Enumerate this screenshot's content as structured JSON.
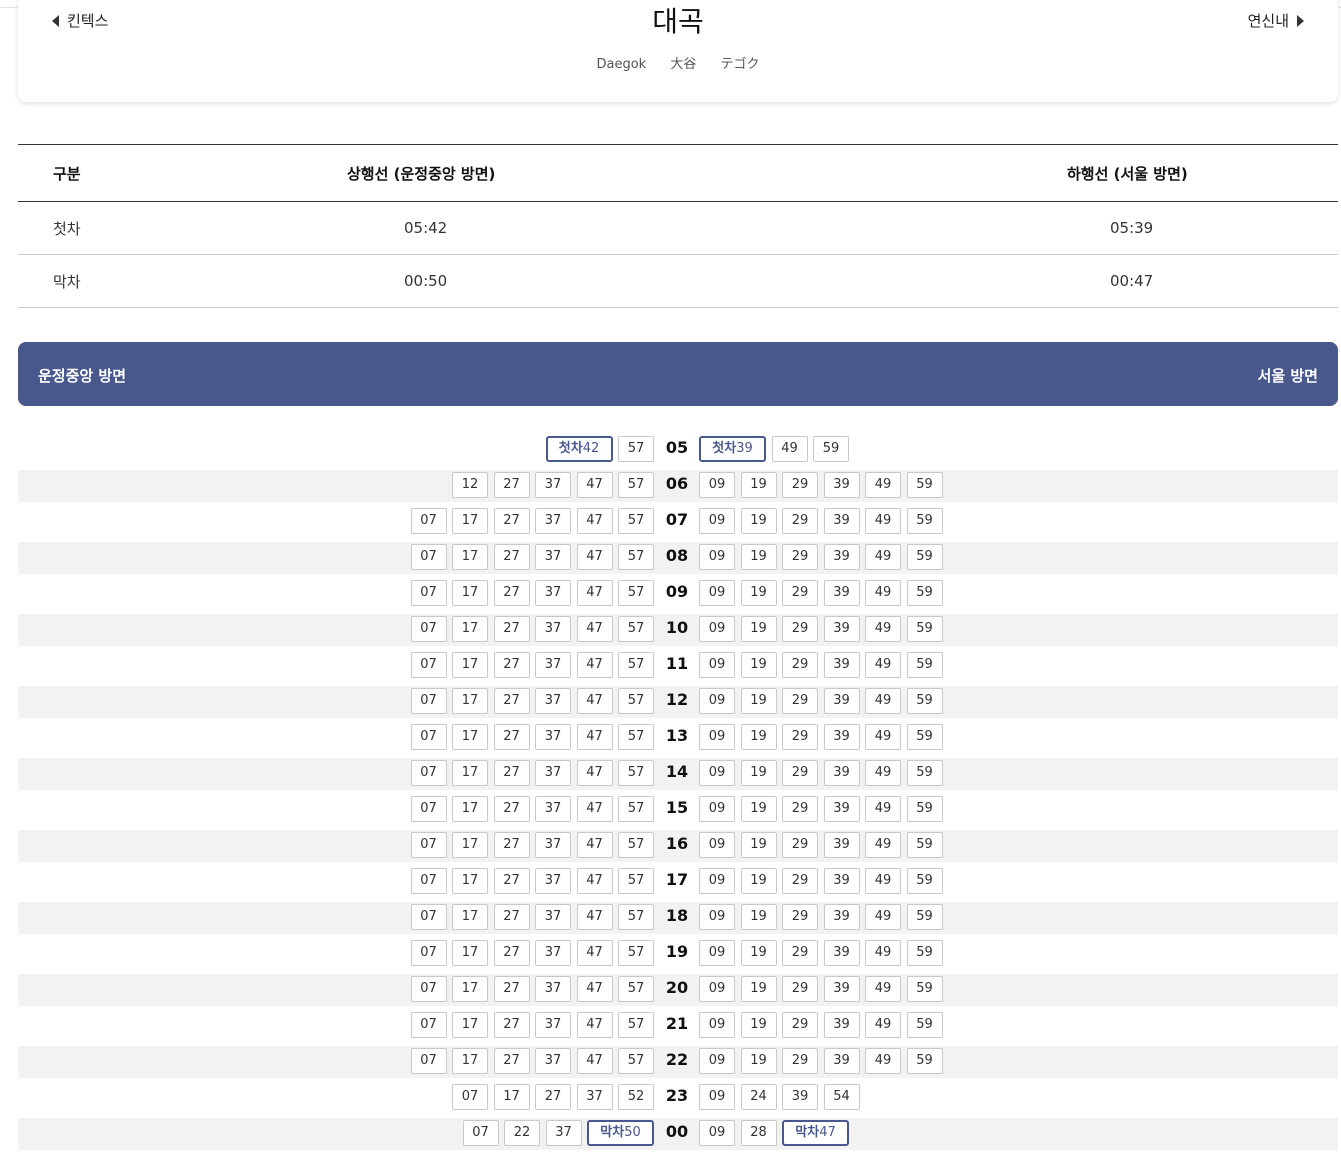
{
  "station": {
    "prev": "킨텍스",
    "next": "연신내",
    "name": "대곡",
    "en": "Daegok",
    "zh": "大谷",
    "ja": "テゴク"
  },
  "summary": {
    "headers": [
      "구분",
      "상행선 (운정중앙 방면)",
      "하행선 (서울 방면)"
    ],
    "rows": [
      [
        "첫차",
        "05:42",
        "05:39"
      ],
      [
        "막차",
        "00:50",
        "00:47"
      ]
    ]
  },
  "directions": {
    "left": "운정중앙 방면",
    "right": "서울 방면"
  },
  "badges": {
    "first": "첫차",
    "last": "막차"
  },
  "timetable": [
    {
      "hour": "05",
      "up": [
        "첫차42",
        "57"
      ],
      "down": [
        "첫차39",
        "49",
        "59"
      ]
    },
    {
      "hour": "06",
      "up": [
        "12",
        "27",
        "37",
        "47",
        "57"
      ],
      "down": [
        "09",
        "19",
        "29",
        "39",
        "49",
        "59"
      ]
    },
    {
      "hour": "07",
      "up": [
        "07",
        "17",
        "27",
        "37",
        "47",
        "57"
      ],
      "down": [
        "09",
        "19",
        "29",
        "39",
        "49",
        "59"
      ]
    },
    {
      "hour": "08",
      "up": [
        "07",
        "17",
        "27",
        "37",
        "47",
        "57"
      ],
      "down": [
        "09",
        "19",
        "29",
        "39",
        "49",
        "59"
      ]
    },
    {
      "hour": "09",
      "up": [
        "07",
        "17",
        "27",
        "37",
        "47",
        "57"
      ],
      "down": [
        "09",
        "19",
        "29",
        "39",
        "49",
        "59"
      ]
    },
    {
      "hour": "10",
      "up": [
        "07",
        "17",
        "27",
        "37",
        "47",
        "57"
      ],
      "down": [
        "09",
        "19",
        "29",
        "39",
        "49",
        "59"
      ]
    },
    {
      "hour": "11",
      "up": [
        "07",
        "17",
        "27",
        "37",
        "47",
        "57"
      ],
      "down": [
        "09",
        "19",
        "29",
        "39",
        "49",
        "59"
      ]
    },
    {
      "hour": "12",
      "up": [
        "07",
        "17",
        "27",
        "37",
        "47",
        "57"
      ],
      "down": [
        "09",
        "19",
        "29",
        "39",
        "49",
        "59"
      ]
    },
    {
      "hour": "13",
      "up": [
        "07",
        "17",
        "27",
        "37",
        "47",
        "57"
      ],
      "down": [
        "09",
        "19",
        "29",
        "39",
        "49",
        "59"
      ]
    },
    {
      "hour": "14",
      "up": [
        "07",
        "17",
        "27",
        "37",
        "47",
        "57"
      ],
      "down": [
        "09",
        "19",
        "29",
        "39",
        "49",
        "59"
      ]
    },
    {
      "hour": "15",
      "up": [
        "07",
        "17",
        "27",
        "37",
        "47",
        "57"
      ],
      "down": [
        "09",
        "19",
        "29",
        "39",
        "49",
        "59"
      ]
    },
    {
      "hour": "16",
      "up": [
        "07",
        "17",
        "27",
        "37",
        "47",
        "57"
      ],
      "down": [
        "09",
        "19",
        "29",
        "39",
        "49",
        "59"
      ]
    },
    {
      "hour": "17",
      "up": [
        "07",
        "17",
        "27",
        "37",
        "47",
        "57"
      ],
      "down": [
        "09",
        "19",
        "29",
        "39",
        "49",
        "59"
      ]
    },
    {
      "hour": "18",
      "up": [
        "07",
        "17",
        "27",
        "37",
        "47",
        "57"
      ],
      "down": [
        "09",
        "19",
        "29",
        "39",
        "49",
        "59"
      ]
    },
    {
      "hour": "19",
      "up": [
        "07",
        "17",
        "27",
        "37",
        "47",
        "57"
      ],
      "down": [
        "09",
        "19",
        "29",
        "39",
        "49",
        "59"
      ]
    },
    {
      "hour": "20",
      "up": [
        "07",
        "17",
        "27",
        "37",
        "47",
        "57"
      ],
      "down": [
        "09",
        "19",
        "29",
        "39",
        "49",
        "59"
      ]
    },
    {
      "hour": "21",
      "up": [
        "07",
        "17",
        "27",
        "37",
        "47",
        "57"
      ],
      "down": [
        "09",
        "19",
        "29",
        "39",
        "49",
        "59"
      ]
    },
    {
      "hour": "22",
      "up": [
        "07",
        "17",
        "27",
        "37",
        "47",
        "57"
      ],
      "down": [
        "09",
        "19",
        "29",
        "39",
        "49",
        "59"
      ]
    },
    {
      "hour": "23",
      "up": [
        "07",
        "17",
        "27",
        "37",
        "52"
      ],
      "down": [
        "09",
        "24",
        "39",
        "54"
      ]
    },
    {
      "hour": "00",
      "up": [
        "07",
        "22",
        "37",
        "막차50"
      ],
      "down": [
        "09",
        "28",
        "막차47"
      ]
    }
  ],
  "colors": {
    "accent": "#48578c",
    "row_alt": "#f2f2f2"
  }
}
